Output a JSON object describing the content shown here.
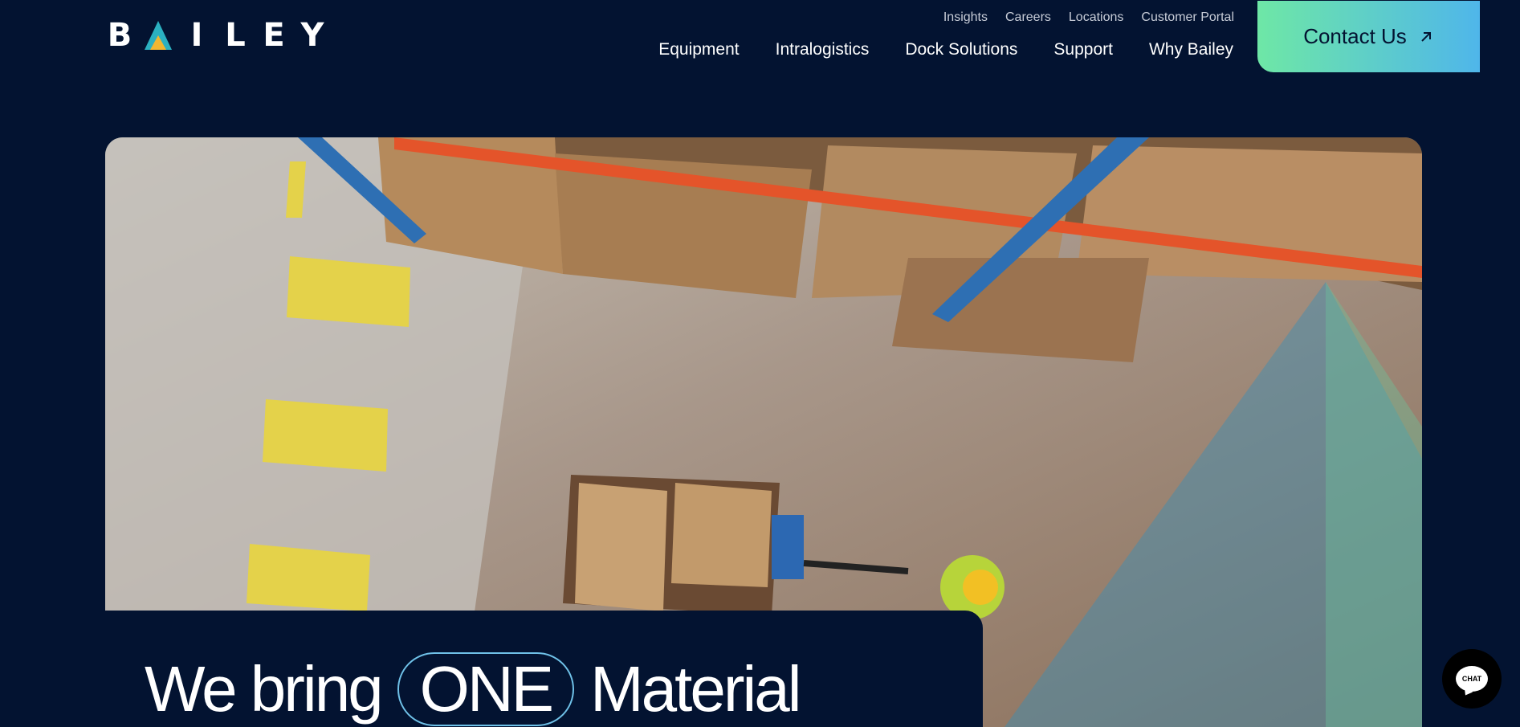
{
  "brand": {
    "logo_letters": [
      "B",
      "I",
      "L",
      "E",
      "Y"
    ],
    "logo_text": "BAILEY",
    "colors": {
      "navy": "#031331",
      "teal": "#2bb0c0",
      "yellow": "#f2b630",
      "gradient_start": "#6ee7a6",
      "gradient_end": "#4fb6ea"
    }
  },
  "top_nav": {
    "items": [
      {
        "label": "Insights"
      },
      {
        "label": "Careers"
      },
      {
        "label": "Locations"
      },
      {
        "label": "Customer Portal"
      }
    ]
  },
  "main_nav": {
    "items": [
      {
        "label": "Equipment"
      },
      {
        "label": "Intralogistics"
      },
      {
        "label": "Dock Solutions"
      },
      {
        "label": "Support"
      },
      {
        "label": "Why Bailey"
      }
    ]
  },
  "contact": {
    "label": "Contact Us",
    "icon": "arrow-up-right-icon"
  },
  "hero": {
    "image_icon": "warehouse-photo",
    "headline_before": "We bring",
    "headline_pill": "ONE",
    "headline_after": "Material"
  },
  "chat": {
    "label": "CHAT",
    "icon": "chat-bubble-icon"
  }
}
